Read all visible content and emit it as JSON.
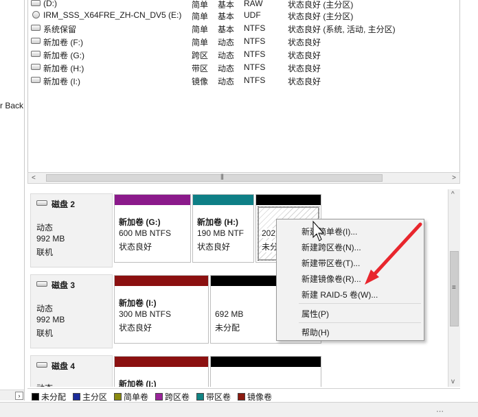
{
  "sidebar": {
    "label": "r Back"
  },
  "volumes": [
    {
      "name": "(D:)",
      "layout": "简单",
      "type": "基本",
      "fs": "RAW",
      "status": "状态良好 (主分区)",
      "icon": "drive-icon"
    },
    {
      "name": "IRM_SSS_X64FRE_ZH-CN_DV5 (E:)",
      "layout": "简单",
      "type": "基本",
      "fs": "UDF",
      "status": "状态良好 (主分区)",
      "icon": "cd-drive-icon"
    },
    {
      "name": "系统保留",
      "layout": "简单",
      "type": "基本",
      "fs": "NTFS",
      "status": "状态良好 (系统, 活动, 主分区)",
      "icon": "drive-icon"
    },
    {
      "name": "新加卷 (F:)",
      "layout": "简单",
      "type": "动态",
      "fs": "NTFS",
      "status": "状态良好",
      "icon": "drive-icon"
    },
    {
      "name": "新加卷 (G:)",
      "layout": "跨区",
      "type": "动态",
      "fs": "NTFS",
      "status": "状态良好",
      "icon": "drive-icon"
    },
    {
      "name": "新加卷 (H:)",
      "layout": "带区",
      "type": "动态",
      "fs": "NTFS",
      "status": "状态良好",
      "icon": "drive-icon"
    },
    {
      "name": "新加卷 (I:)",
      "layout": "镜像",
      "type": "动态",
      "fs": "NTFS",
      "status": "状态良好",
      "icon": "drive-icon"
    }
  ],
  "disks": [
    {
      "name": "磁盘 2",
      "type": "动态",
      "size": "992 MB",
      "state": "联机",
      "partitions": [
        {
          "title": "新加卷 (G:)",
          "size": "600 MB NTFS",
          "status": "状态良好",
          "color": "#8b1a8b"
        },
        {
          "title": "新加卷 (H:)",
          "size": "190 MB NTF",
          "status": "状态良好",
          "color": "#0e7f86"
        },
        {
          "title": "202",
          "size": "",
          "status": "未分",
          "color": "#000000"
        }
      ]
    },
    {
      "name": "磁盘 3",
      "type": "动态",
      "size": "992 MB",
      "state": "联机",
      "partitions": [
        {
          "title": "新加卷 (I:)",
          "size": "300 MB NTFS",
          "status": "状态良好",
          "color": "#8b1010"
        },
        {
          "title": "",
          "size": "692 MB",
          "status": "未分配",
          "color": "#000000"
        }
      ]
    },
    {
      "name": "磁盘 4",
      "type": "动态",
      "size": "",
      "state": "",
      "partitions": [
        {
          "title": "新加卷 (I:)",
          "size": "",
          "status": "",
          "color": "#8b1010"
        },
        {
          "title": "",
          "size": "",
          "status": "",
          "color": "#000000"
        }
      ]
    }
  ],
  "legend": [
    {
      "label": "未分配",
      "color": "#000000"
    },
    {
      "label": "主分区",
      "color": "#1c2c9a"
    },
    {
      "label": "简单卷",
      "color": "#8a8a10"
    },
    {
      "label": "跨区卷",
      "color": "#9a259a"
    },
    {
      "label": "带区卷",
      "color": "#128484"
    },
    {
      "label": "镜像卷",
      "color": "#8b1a10"
    }
  ],
  "context_menu": {
    "items": [
      "新建简单卷(I)...",
      "新建跨区卷(N)...",
      "新建带区卷(T)...",
      "新建镜像卷(R)...",
      "新建 RAID-5 卷(W)...",
      "属性(P)",
      "帮助(H)"
    ]
  },
  "colors": {
    "annotation_arrow": "#e8262d"
  }
}
